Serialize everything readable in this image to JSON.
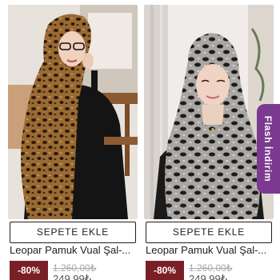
{
  "products": [
    {
      "cta": "SEPETE EKLE",
      "name": "Leopar Pamuk Vual Şal-...",
      "discount": "-80%",
      "old_price": "1.260,00₺",
      "new_price": "249,99₺"
    },
    {
      "cta": "SEPETE EKLE",
      "name": "Leopar Pamuk Vual Şal-...",
      "discount": "-80%",
      "old_price": "1.260,00₺",
      "new_price": "249,99₺"
    }
  ],
  "flash_tab": {
    "label": "Flash İndirim"
  },
  "colors": {
    "accent_purple": "#7b3a8f",
    "discount_red": "#7a1f25"
  }
}
